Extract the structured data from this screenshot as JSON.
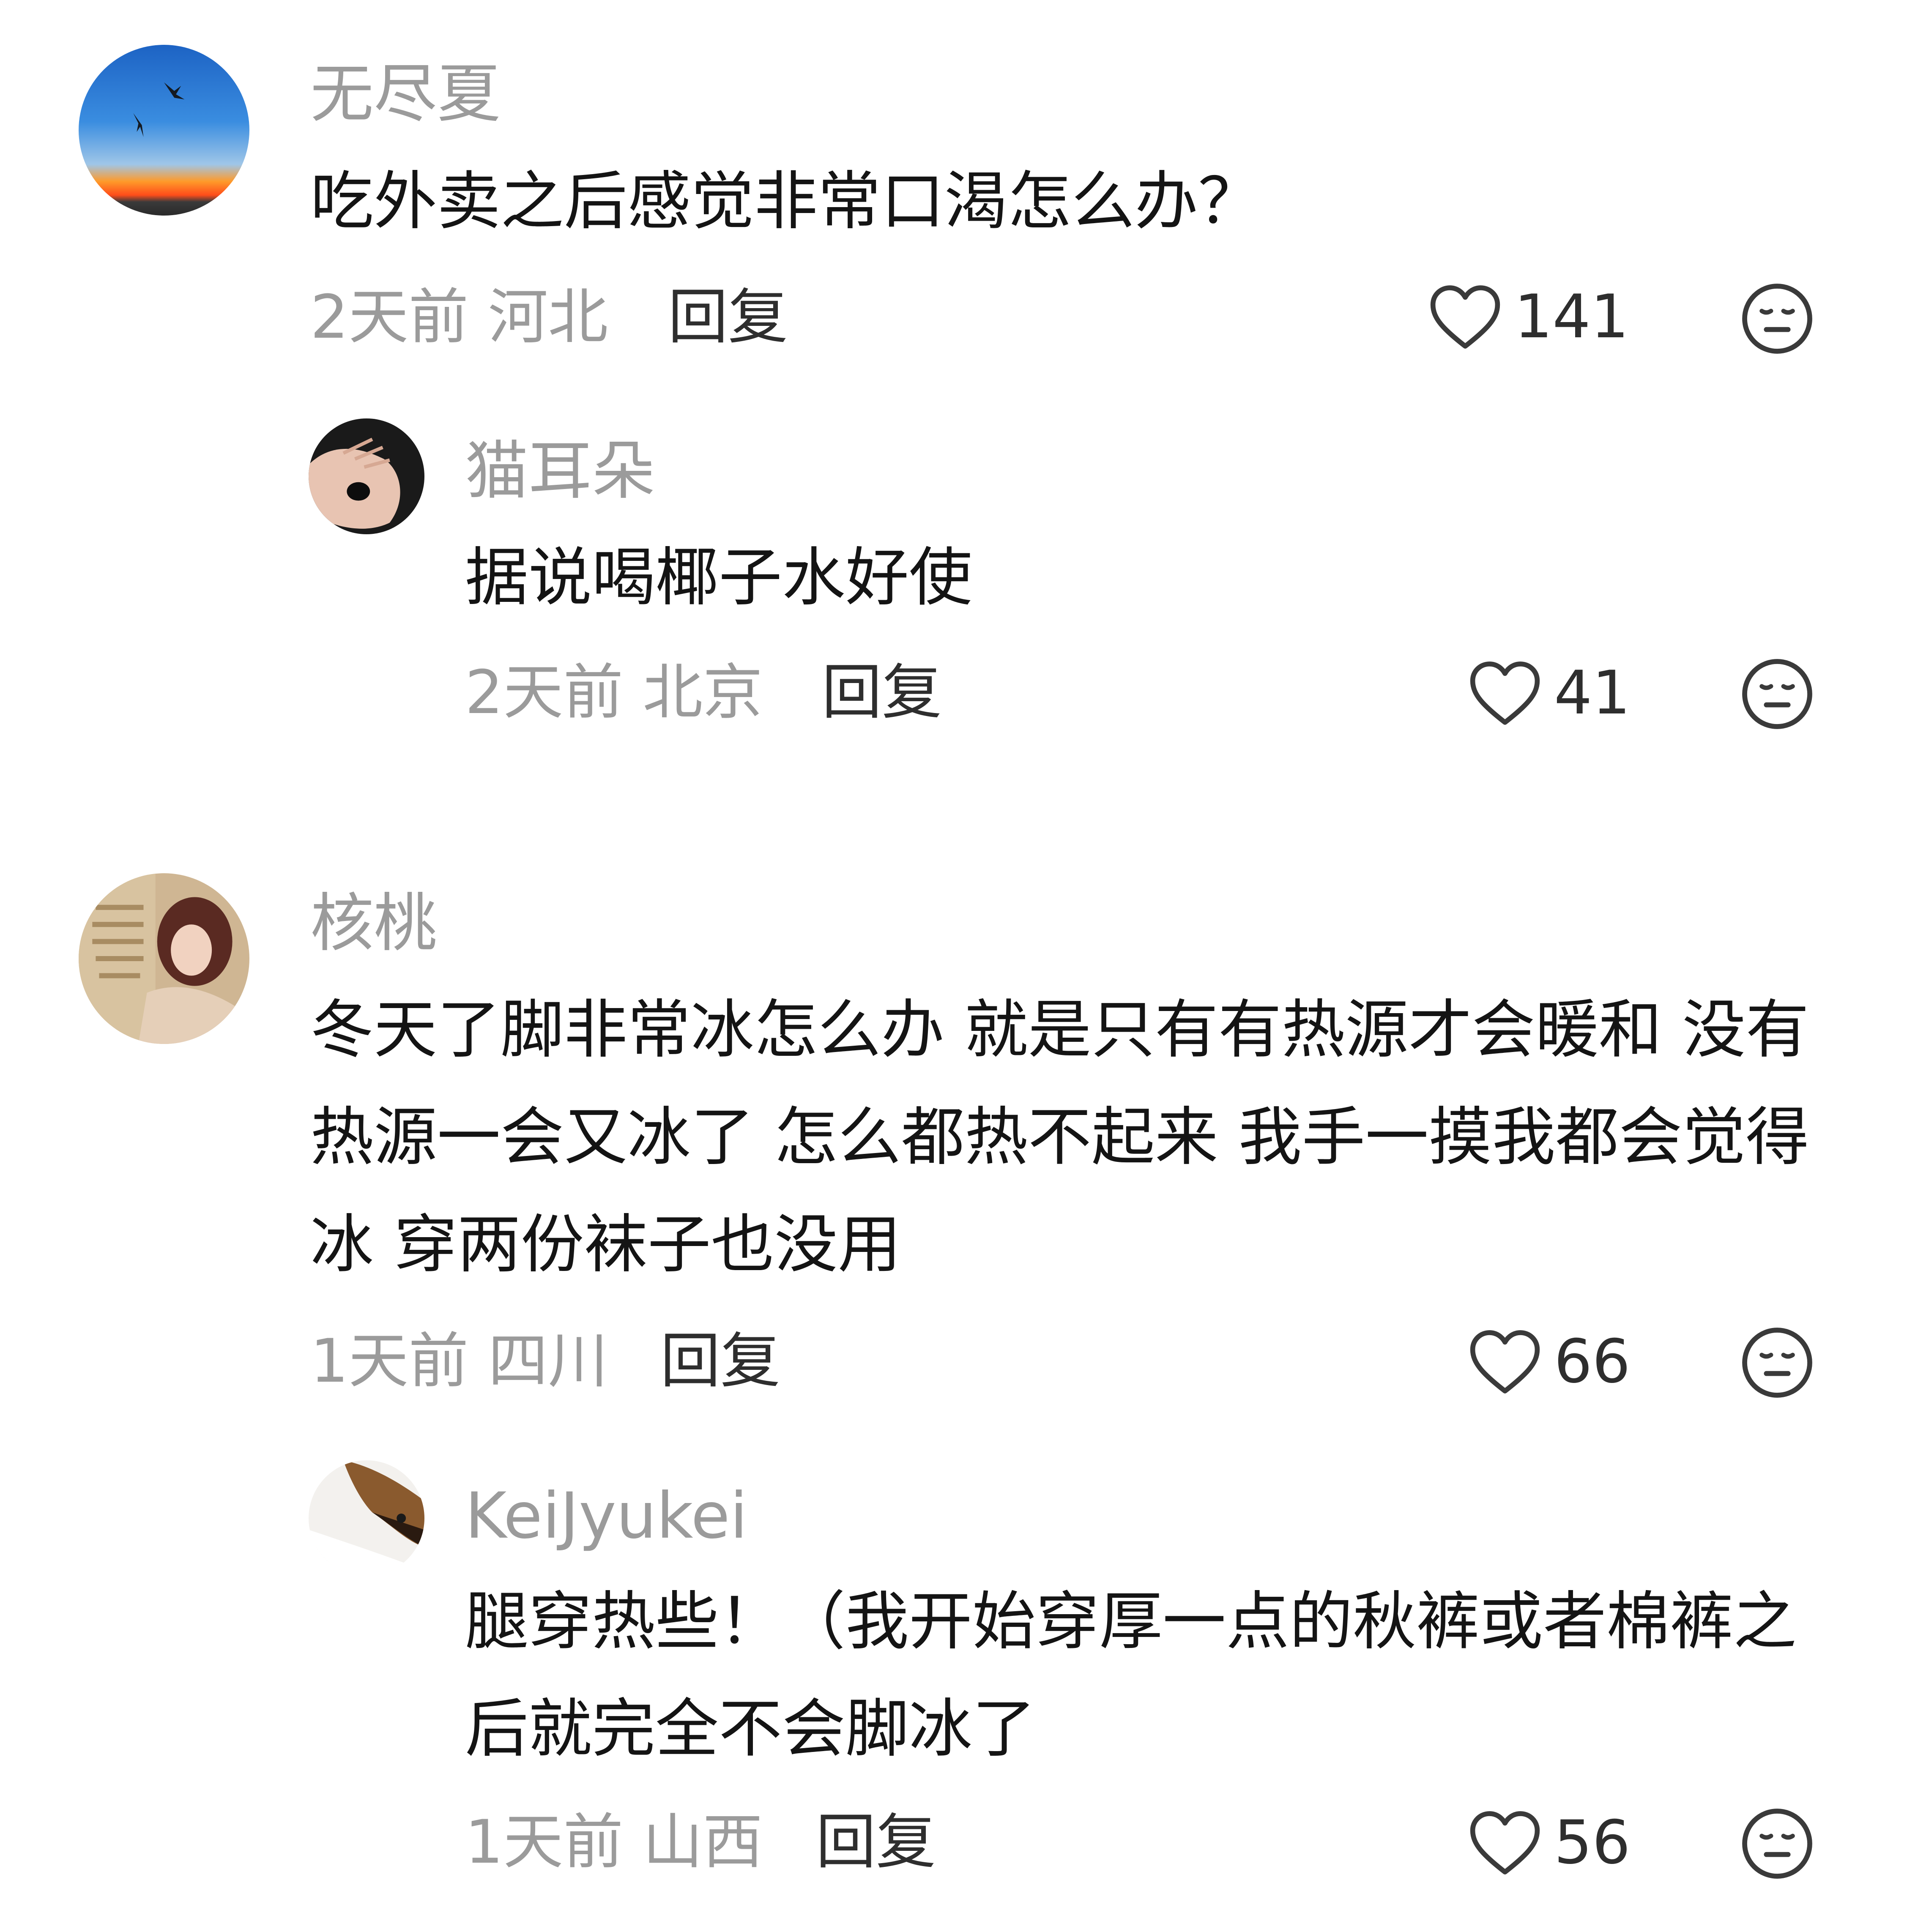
{
  "comments": [
    {
      "username": "无尽夏",
      "text": "吃外卖之后感觉非常口渴怎么办？",
      "time": "2天前",
      "location": "河北",
      "reply_label": "回复",
      "likes": "141",
      "avatar": "sunset-birds-avatar"
    },
    {
      "username": "猫耳朵",
      "text": "据说喝椰子水好使",
      "time": "2天前",
      "location": "北京",
      "reply_label": "回复",
      "likes": "41",
      "avatar": "hand-stone-avatar"
    },
    {
      "username": "核桃",
      "text": "冬天了脚非常冰怎么办 就是只有有热源才会暖和 没有热源一会又冰了 怎么都热不起来 我手一摸我都会觉得冰 穿两份袜子也没用",
      "time": "1天前",
      "location": "四川",
      "reply_label": "回复",
      "likes": "66",
      "avatar": "woman-skeleton-avatar"
    },
    {
      "username": "KeiJyukei",
      "text": "腿穿热些！（我开始穿厚一点的秋裤或者棉裤之后就完全不会脚冰了",
      "time": "1天前",
      "location": "山西",
      "reply_label": "回复",
      "likes": "56",
      "avatar": "dog-avatar"
    }
  ],
  "icons": {
    "like": "heart-outline-icon",
    "dislike": "meh-face-icon"
  },
  "colors": {
    "username": "#9b9b9b",
    "text": "#141414",
    "meta": "#9b9b9b",
    "action": "#2e2e2e"
  }
}
